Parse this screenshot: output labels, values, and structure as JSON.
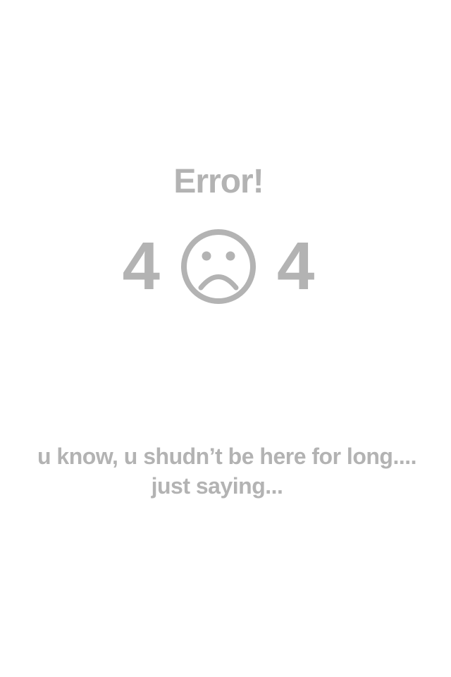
{
  "error": {
    "title": "Error!",
    "code_left": "4",
    "code_right": "4",
    "face_icon": "sad-face-icon",
    "message_line1": "u know, u shudn’t be here for long....",
    "message_line2": "just saying..."
  },
  "colors": {
    "text": "#b3b3b3",
    "background": "#ffffff"
  }
}
